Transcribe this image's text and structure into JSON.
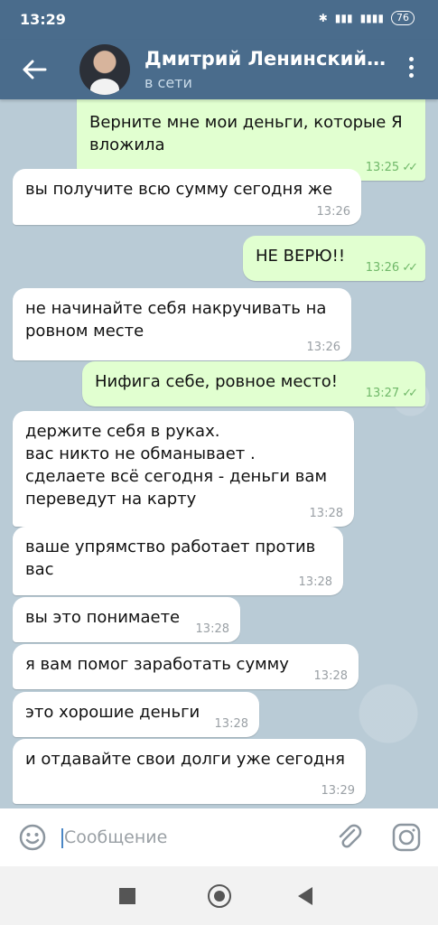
{
  "status_bar": {
    "time": "13:29",
    "icons": [
      "bluetooth-icon",
      "signal-icon",
      "4g-signal-icon"
    ],
    "battery": "76"
  },
  "header": {
    "contact_name": "Дмитрий Ленинский…",
    "status": "в сети",
    "back_icon": "arrow-back-icon",
    "menu_icon": "more-vert-icon"
  },
  "messages": [
    {
      "dir": "out",
      "text": "Верните мне мои деньги, которые Я\nвложила",
      "time": "13:25",
      "read": true
    },
    {
      "dir": "in",
      "text": "вы получите всю сумму сегодня же",
      "time": "13:26"
    },
    {
      "dir": "out",
      "text": "НЕ ВЕРЮ!!",
      "time": "13:26",
      "read": true
    },
    {
      "dir": "in",
      "text": "не начинайте себя накручивать на\nровном месте",
      "time": "13:26"
    },
    {
      "dir": "out",
      "text": "Нифига себе, ровное место!",
      "time": "13:27",
      "read": true
    },
    {
      "dir": "in",
      "text": "держите себя в руках.\nвас никто не обманывает .\nсделаете всё сегодня - деньги вам\nпереведут на карту",
      "time": "13:28"
    },
    {
      "dir": "in",
      "text": "ваше упрямство работает против\nвас",
      "time": "13:28"
    },
    {
      "dir": "in",
      "text": "вы это понимаете",
      "time": "13:28"
    },
    {
      "dir": "in",
      "text": "я вам помог заработать сумму",
      "time": "13:28"
    },
    {
      "dir": "in",
      "text": "это хорошие деньги",
      "time": "13:28"
    },
    {
      "dir": "in",
      "text": "и отдавайте свои долги уже сегодня",
      "time": "13:29"
    }
  ],
  "input": {
    "placeholder": "Сообщение",
    "emoji_icon": "emoji-icon",
    "attach_icon": "paperclip-icon",
    "camera_icon": "camera-icon"
  },
  "nav": {
    "icons": [
      "recents-square-icon",
      "home-circle-icon",
      "back-triangle-icon"
    ]
  },
  "colors": {
    "header": "#4a6c8c",
    "chat_bg": "#b9cbd6",
    "outgoing_bubble": "#e1ffd0",
    "incoming_bubble": "#ffffff",
    "read_ticks": "#70b869"
  }
}
